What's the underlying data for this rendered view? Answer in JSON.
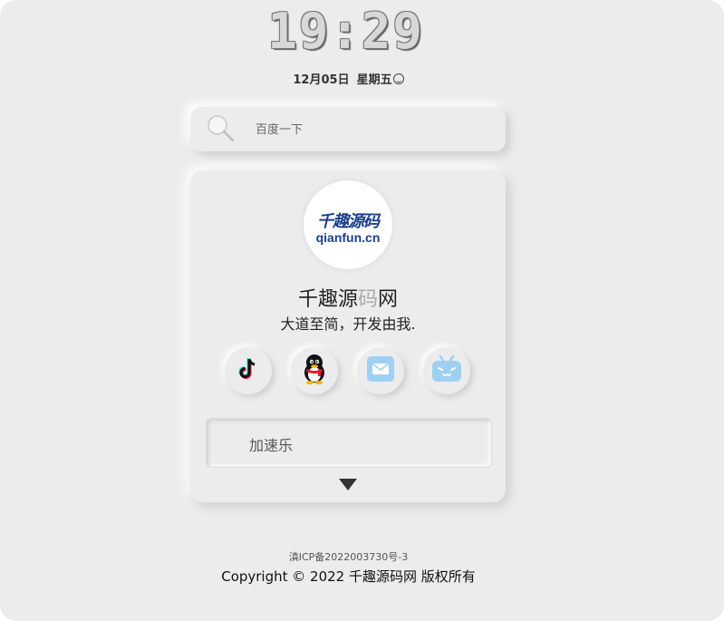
{
  "clock": {
    "time": "19:29"
  },
  "date": {
    "date": "12月05日",
    "weekday": "星期五"
  },
  "search": {
    "placeholder": "百度一下",
    "value": ""
  },
  "profile": {
    "logo_cn": "千趣源码",
    "logo_en": "qianfun.cn",
    "title_a": "千趣源",
    "title_b": "码",
    "title_c": "网",
    "tagline": "大道至简，开发由我."
  },
  "social": [
    {
      "icon": "tiktok-icon"
    },
    {
      "icon": "qq-icon"
    },
    {
      "icon": "mail-icon"
    },
    {
      "icon": "bilibili-icon"
    }
  ],
  "links": [
    {
      "label": "加速乐"
    }
  ],
  "footer": {
    "icp": "滇ICP备2022003730号-3",
    "copyright": "Copyright © 2022 千趣源码网 版权所有"
  },
  "colors": {
    "background": "#ececec",
    "accent_blue": "#1c3f8a",
    "icon_light_blue": "#9fd0f2"
  }
}
